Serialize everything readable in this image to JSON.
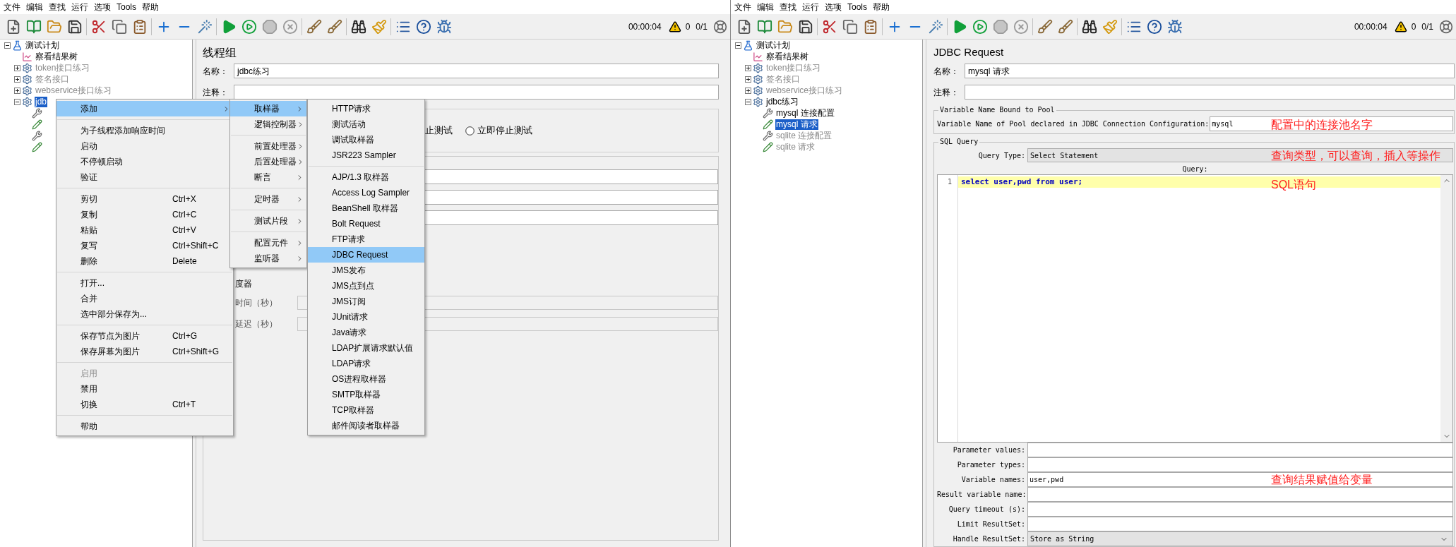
{
  "windows": [
    {
      "menu_bar": [
        "文件",
        "编辑",
        "查找",
        "运行",
        "选项",
        "Tools",
        "帮助"
      ],
      "toolbar": {
        "elapsed": "00:00:04",
        "warnings": "0",
        "threads": "0/1"
      },
      "tree": [
        {
          "label": "测试计划",
          "kind": "plan",
          "selected": false,
          "disabled": false,
          "expanded": true,
          "children": [
            {
              "label": "察看结果树",
              "kind": "listener",
              "selected": false,
              "disabled": false
            },
            {
              "label": "token接口练习",
              "kind": "thread_group",
              "selected": false,
              "disabled": true,
              "expanded": false
            },
            {
              "label": "签名接口",
              "kind": "thread_group",
              "selected": false,
              "disabled": true,
              "expanded": false
            },
            {
              "label": "webservice接口练习",
              "kind": "thread_group",
              "selected": false,
              "disabled": true,
              "expanded": false
            },
            {
              "label": "jdb",
              "kind": "thread_group",
              "selected": true,
              "disabled": false,
              "expanded": true,
              "children": [
                {
                  "kind": "config"
                },
                {
                  "kind": "sampler"
                },
                {
                  "kind": "config"
                },
                {
                  "kind": "sampler"
                }
              ]
            }
          ]
        }
      ],
      "thread_group_panel": {
        "title": "线程组",
        "name_label": "名称：",
        "name_value": "jdbc练习",
        "comment_label": "注释：",
        "action_fragment": "止测试",
        "radio": {
          "label": "立即停止测试",
          "selected": false
        },
        "scheduler_fragment": "度器",
        "scheduler_rows": [
          {
            "label": "时间（秒）",
            "disabled": true
          },
          {
            "label": "延迟（秒）",
            "disabled": true
          }
        ]
      },
      "context_menu": {
        "groups": [
          [
            {
              "label": "添加",
              "selected": true,
              "disabled": false,
              "has_submenu": true
            }
          ],
          [
            {
              "label": "为子线程添加响应时间",
              "selected": false,
              "disabled": false,
              "has_submenu": false
            },
            {
              "label": "启动",
              "selected": false,
              "disabled": false,
              "has_submenu": false
            },
            {
              "label": "不停顿启动",
              "selected": false,
              "disabled": false,
              "has_submenu": false
            },
            {
              "label": "验证",
              "selected": false,
              "disabled": false,
              "has_submenu": false
            }
          ],
          [
            {
              "label": "剪切",
              "shortcut": "Ctrl+X",
              "selected": false,
              "disabled": false,
              "has_submenu": false
            },
            {
              "label": "复制",
              "shortcut": "Ctrl+C",
              "selected": false,
              "disabled": false,
              "has_submenu": false
            },
            {
              "label": "粘贴",
              "shortcut": "Ctrl+V",
              "selected": false,
              "disabled": false,
              "has_submenu": false
            },
            {
              "label": "复写",
              "shortcut": "Ctrl+Shift+C",
              "selected": false,
              "disabled": false,
              "has_submenu": false
            },
            {
              "label": "删除",
              "shortcut": "Delete",
              "selected": false,
              "disabled": false,
              "has_submenu": false
            }
          ],
          [
            {
              "label": "打开...",
              "selected": false,
              "disabled": false,
              "has_submenu": false
            },
            {
              "label": "合并",
              "selected": false,
              "disabled": false,
              "has_submenu": false
            },
            {
              "label": "选中部分保存为...",
              "selected": false,
              "disabled": false,
              "has_submenu": false
            }
          ],
          [
            {
              "label": "保存节点为图片",
              "shortcut": "Ctrl+G",
              "selected": false,
              "disabled": false,
              "has_submenu": false
            },
            {
              "label": "保存屏幕为图片",
              "shortcut": "Ctrl+Shift+G",
              "selected": false,
              "disabled": false,
              "has_submenu": false
            }
          ],
          [
            {
              "label": "启用",
              "selected": false,
              "disabled": true,
              "has_submenu": false
            },
            {
              "label": "禁用",
              "selected": false,
              "disabled": false,
              "has_submenu": false
            },
            {
              "label": "切换",
              "shortcut": "Ctrl+T",
              "selected": false,
              "disabled": false,
              "has_submenu": false
            }
          ],
          [
            {
              "label": "帮助",
              "selected": false,
              "disabled": false,
              "has_submenu": false
            }
          ]
        ],
        "submenu": {
          "groups": [
            [
              {
                "label": "取样器",
                "selected": true,
                "disabled": false,
                "has_submenu": true
              },
              {
                "label": "逻辑控制器",
                "selected": false,
                "disabled": false,
                "has_submenu": true
              }
            ],
            [
              {
                "label": "前置处理器",
                "selected": false,
                "disabled": false,
                "has_submenu": true
              },
              {
                "label": "后置处理器",
                "selected": false,
                "disabled": false,
                "has_submenu": true
              },
              {
                "label": "断言",
                "selected": false,
                "disabled": false,
                "has_submenu": true
              }
            ],
            [
              {
                "label": "定时器",
                "selected": false,
                "disabled": false,
                "has_submenu": true
              }
            ],
            [
              {
                "label": "测试片段",
                "selected": false,
                "disabled": false,
                "has_submenu": true
              }
            ],
            [
              {
                "label": "配置元件",
                "selected": false,
                "disabled": false,
                "has_submenu": true
              },
              {
                "label": "监听器",
                "selected": false,
                "disabled": false,
                "has_submenu": true
              }
            ]
          ],
          "submenu": {
            "groups": [
              [
                {
                  "label": "HTTP请求",
                  "selected": false,
                  "disabled": false
                },
                {
                  "label": "测试活动",
                  "selected": false,
                  "disabled": false
                },
                {
                  "label": "调试取样器",
                  "selected": false,
                  "disabled": false
                },
                {
                  "label": "JSR223 Sampler",
                  "selected": false,
                  "disabled": false
                }
              ],
              [
                {
                  "label": "AJP/1.3 取样器",
                  "selected": false,
                  "disabled": false
                },
                {
                  "label": "Access Log Sampler",
                  "selected": false,
                  "disabled": false
                },
                {
                  "label": "BeanShell 取样器",
                  "selected": false,
                  "disabled": false
                },
                {
                  "label": "Bolt Request",
                  "selected": false,
                  "disabled": false
                },
                {
                  "label": "FTP请求",
                  "selected": false,
                  "disabled": false
                },
                {
                  "label": "JDBC Request",
                  "selected": true,
                  "disabled": false
                },
                {
                  "label": "JMS发布",
                  "selected": false,
                  "disabled": false
                },
                {
                  "label": "JMS点到点",
                  "selected": false,
                  "disabled": false
                },
                {
                  "label": "JMS订阅",
                  "selected": false,
                  "disabled": false
                },
                {
                  "label": "JUnit请求",
                  "selected": false,
                  "disabled": false
                },
                {
                  "label": "Java请求",
                  "selected": false,
                  "disabled": false
                },
                {
                  "label": "LDAP扩展请求默认值",
                  "selected": false,
                  "disabled": false
                },
                {
                  "label": "LDAP请求",
                  "selected": false,
                  "disabled": false
                },
                {
                  "label": "OS进程取样器",
                  "selected": false,
                  "disabled": false
                },
                {
                  "label": "SMTP取样器",
                  "selected": false,
                  "disabled": false
                },
                {
                  "label": "TCP取样器",
                  "selected": false,
                  "disabled": false
                },
                {
                  "label": "邮件阅读者取样器",
                  "selected": false,
                  "disabled": false
                }
              ]
            ]
          }
        }
      }
    },
    {
      "menu_bar": [
        "文件",
        "编辑",
        "查找",
        "运行",
        "选项",
        "Tools",
        "帮助"
      ],
      "toolbar": {
        "elapsed": "00:00:04",
        "warnings": "0",
        "threads": "0/1"
      },
      "tree": [
        {
          "label": "测试计划",
          "kind": "plan",
          "selected": false,
          "disabled": false,
          "expanded": true,
          "children": [
            {
              "label": "察看结果树",
              "kind": "listener",
              "selected": false,
              "disabled": false
            },
            {
              "label": "token接口练习",
              "kind": "thread_group",
              "selected": false,
              "disabled": true,
              "expanded": false
            },
            {
              "label": "签名接口",
              "kind": "thread_group",
              "selected": false,
              "disabled": true,
              "expanded": false
            },
            {
              "label": "webservice接口练习",
              "kind": "thread_group",
              "selected": false,
              "disabled": true,
              "expanded": false
            },
            {
              "label": "jdbc练习",
              "kind": "thread_group",
              "selected": false,
              "disabled": false,
              "expanded": true,
              "children": [
                {
                  "label": "mysql 连接配置",
                  "kind": "config",
                  "selected": false,
                  "disabled": false
                },
                {
                  "label": "mysql 请求",
                  "kind": "sampler",
                  "selected": true,
                  "disabled": false
                },
                {
                  "label": "sqlite 连接配置",
                  "kind": "config",
                  "selected": false,
                  "disabled": true
                },
                {
                  "label": "sqlite 请求",
                  "kind": "sampler",
                  "selected": false,
                  "disabled": true
                }
              ]
            }
          ]
        }
      ],
      "jdbc_request_panel": {
        "title": "JDBC Request",
        "name_label": "名称：",
        "name_value": "mysql 请求",
        "comment_label": "注释：",
        "pool_group": {
          "legend": "Variable Name Bound to Pool",
          "label": "Variable Name of Pool declared in JDBC Connection Configuration:",
          "value": "mysql"
        },
        "sql_group": {
          "legend": "SQL Query",
          "query_type_label": "Query Type:",
          "query_type_value": "Select Statement",
          "query_label": "Query:",
          "line_number": "1",
          "code": "select user,pwd from user;",
          "params": [
            {
              "label": "Parameter values:",
              "kind": "text"
            },
            {
              "label": "Parameter types:",
              "kind": "text"
            },
            {
              "label": "Variable names:",
              "kind": "text",
              "value": "user,pwd"
            },
            {
              "label": "Result variable name:",
              "kind": "text"
            },
            {
              "label": "Query timeout (s):",
              "kind": "text"
            },
            {
              "label": "Limit ResultSet:",
              "kind": "text"
            },
            {
              "label": "Handle ResultSet:",
              "kind": "dropdown",
              "value": "Store as String"
            }
          ]
        },
        "annotations": [
          "配置中的连接池名字",
          "查询类型，可以查询，插入等操作",
          "SQL语句",
          "查询结果赋值给变量"
        ]
      }
    }
  ]
}
